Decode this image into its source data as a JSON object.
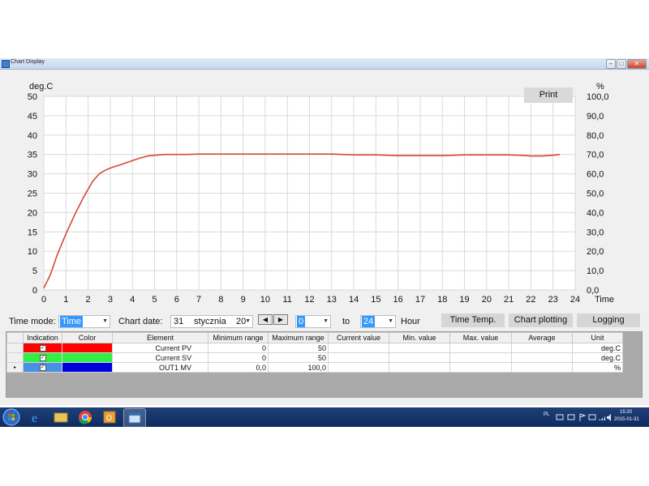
{
  "window": {
    "title": "Chart Display"
  },
  "chart": {
    "print_label": "Print",
    "left_unit": "deg.C",
    "right_unit": "%",
    "x_label": "Time"
  },
  "chart_data": {
    "type": "line",
    "title": "",
    "ylabel": "deg.C",
    "y2label": "%",
    "xlabel": "Time",
    "xlim": [
      0,
      24
    ],
    "ylim": [
      0,
      50
    ],
    "y2lim": [
      0,
      100
    ],
    "x_ticks": [
      "0",
      "1",
      "2",
      "3",
      "4",
      "5",
      "6",
      "7",
      "8",
      "9",
      "10",
      "11",
      "12",
      "13",
      "14",
      "15",
      "16",
      "17",
      "18",
      "19",
      "20",
      "21",
      "22",
      "23",
      "24"
    ],
    "y_ticks": [
      "0",
      "5",
      "10",
      "15",
      "20",
      "25",
      "30",
      "35",
      "40",
      "45",
      "50"
    ],
    "y2_ticks": [
      "0,0",
      "10,0",
      "20,0",
      "30,0",
      "40,0",
      "50,0",
      "60,0",
      "70,0",
      "80,0",
      "90,0",
      "100,0"
    ],
    "grid": true,
    "series": [
      {
        "color": "#d44a3a",
        "x": [
          0,
          0.3,
          0.6,
          1.0,
          1.4,
          1.8,
          2.2,
          2.5,
          2.8,
          3.1,
          3.5,
          3.9,
          4.3,
          4.7,
          5.0,
          5.5,
          6.0,
          6.5,
          7,
          8,
          9,
          10,
          11,
          12,
          13,
          13.5,
          14,
          15,
          15.5,
          16,
          17,
          18,
          18.5,
          19,
          20,
          21,
          21.5,
          22,
          22.5,
          23,
          23.3
        ],
        "y": [
          0.5,
          4,
          9,
          14.5,
          19.5,
          24,
          28,
          30,
          31,
          31.7,
          32.4,
          33.2,
          34,
          34.6,
          34.8,
          35,
          35,
          35,
          35.1,
          35.1,
          35.1,
          35.1,
          35.1,
          35.1,
          35.1,
          35,
          34.9,
          34.9,
          34.8,
          34.7,
          34.7,
          34.7,
          34.8,
          34.9,
          34.9,
          34.9,
          34.8,
          34.6,
          34.6,
          34.8,
          35
        ]
      }
    ]
  },
  "controls": {
    "time_mode_label": "Time mode:",
    "time_mode_value": "Time",
    "chart_date_label": "Chart date:",
    "date_day": "31",
    "date_month": "stycznia",
    "date_year": "20",
    "from_value": "0",
    "to_label": "to",
    "to_value": "24",
    "hour_label": "Hour",
    "time_temp_label": "Time  Temp.",
    "chart_plotting_label": "Chart plotting",
    "logging_label": "Logging"
  },
  "table": {
    "headers": [
      "Indication",
      "Color",
      "Element",
      "Minimum range",
      "Maximum range",
      "Current value",
      "Min. value",
      "Max. value",
      "Average",
      "Unit"
    ],
    "rows": [
      {
        "element": "Current PV",
        "color": "#ff0000",
        "min": "0",
        "max": "50",
        "current": "",
        "minv": "",
        "maxv": "",
        "avg": "",
        "unit": "deg.C"
      },
      {
        "element": "Current SV",
        "color": "#33ee44",
        "min": "0",
        "max": "50",
        "current": "",
        "minv": "",
        "maxv": "",
        "avg": "",
        "unit": "deg.C"
      },
      {
        "element": "OUT1 MV",
        "color": "#0000dd",
        "min": "0,0",
        "max": "100,0",
        "current": "",
        "minv": "",
        "maxv": "",
        "avg": "",
        "unit": "%"
      }
    ]
  },
  "taskbar": {
    "lang": "PL",
    "time": "15:20",
    "date": "2015-01-31"
  }
}
